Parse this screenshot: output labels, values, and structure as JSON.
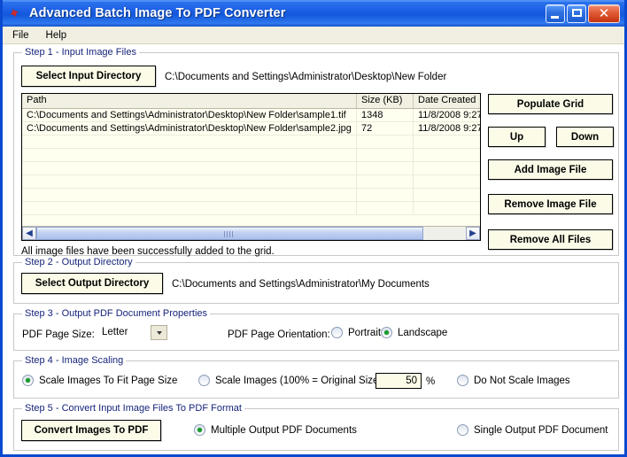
{
  "window": {
    "title": "Advanced Batch Image To PDF Converter",
    "icon": "app-icon",
    "buttons": {
      "minimize": "minimize-button",
      "maximize": "maximize-button",
      "close": "✕"
    }
  },
  "menubar": {
    "items": [
      {
        "label": "File"
      },
      {
        "label": "Help"
      }
    ]
  },
  "step1": {
    "legend": "Step 1 - Input Image Files",
    "select_input_directory_label": "Select Input Directory",
    "input_directory_path": "C:\\Documents and Settings\\Administrator\\Desktop\\New Folder",
    "grid": {
      "columns": [
        "Path",
        "Size (KB)",
        "Date Created"
      ],
      "rows": [
        {
          "path": "C:\\Documents and Settings\\Administrator\\Desktop\\New Folder\\sample1.tif",
          "size": "1348",
          "date": "11/8/2008 9:27"
        },
        {
          "path": "C:\\Documents and Settings\\Administrator\\Desktop\\New Folder\\sample2.jpg",
          "size": "72",
          "date": "11/8/2008 9:27"
        }
      ],
      "empty_row_count": 6
    },
    "scrollbar": {
      "left_arrow": "◀",
      "right_arrow": "▶"
    },
    "status_message": "All image files have been successfully added to the grid.",
    "buttons": {
      "populate_grid": "Populate Grid",
      "up": "Up",
      "down": "Down",
      "add_image_file": "Add Image File",
      "remove_image_file": "Remove Image File",
      "remove_all_files": "Remove All Files"
    }
  },
  "step2": {
    "legend": "Step 2 - Output Directory",
    "select_output_directory_label": "Select Output Directory",
    "output_directory_path": "C:\\Documents and Settings\\Administrator\\My Documents"
  },
  "step3": {
    "legend": "Step 3 - Output PDF Document Properties",
    "page_size_label": "PDF Page Size:",
    "page_size_value": "Letter",
    "orientation_label": "PDF Page Orientation:",
    "orientation_options": [
      {
        "label": "Portrait",
        "selected": false
      },
      {
        "label": "Landscape",
        "selected": true
      }
    ]
  },
  "step4": {
    "legend": "Step 4 - Image Scaling",
    "options": [
      {
        "label": "Scale Images To Fit Page Size",
        "selected": true
      },
      {
        "label": "Scale Images (100% = Original Size)",
        "selected": false
      },
      {
        "label": "Do Not Scale Images",
        "selected": false
      }
    ],
    "scale_value": "50",
    "percent_symbol": "%"
  },
  "step5": {
    "legend": "Step 5 - Convert Input Image Files To PDF Format",
    "convert_button_label": "Convert Images To PDF",
    "options": [
      {
        "label": "Multiple Output PDF Documents",
        "selected": true
      },
      {
        "label": "Single Output PDF Document",
        "selected": false
      }
    ]
  },
  "colors": {
    "title_blue": "#1b5fe4",
    "legend_navy": "#16247a",
    "button_face": "#fbfbe8",
    "grid_bg": "#fffff0",
    "radio_green": "#1a9b2e"
  }
}
